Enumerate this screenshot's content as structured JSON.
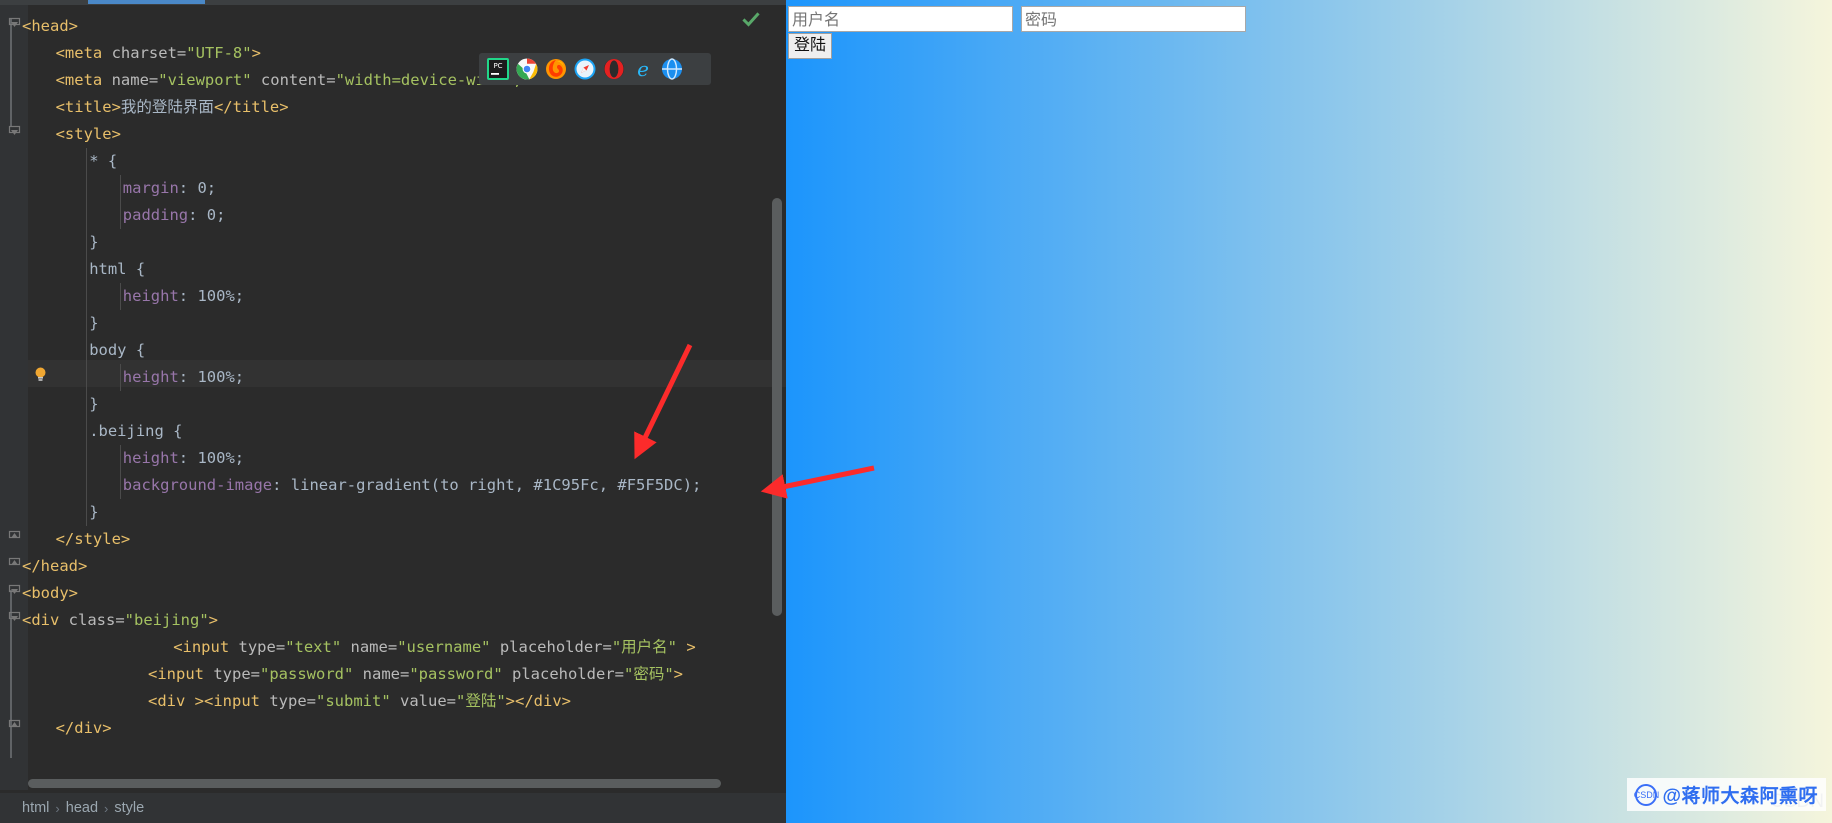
{
  "ide": {
    "breadcrumb": {
      "items": [
        "html",
        "head",
        "style"
      ],
      "separator": "›"
    },
    "inspection_status_icon": "green-check-icon",
    "browser_popup": {
      "icons": [
        {
          "name": "pycharm-icon",
          "label": "PC"
        },
        {
          "name": "chrome-icon",
          "label": ""
        },
        {
          "name": "firefox-icon",
          "label": ""
        },
        {
          "name": "safari-icon",
          "label": ""
        },
        {
          "name": "opera-icon",
          "label": "O"
        },
        {
          "name": "edge-ie-icon",
          "label": "e"
        },
        {
          "name": "extra-browser-icon",
          "label": ""
        }
      ]
    },
    "code": {
      "lines": [
        {
          "indent": 0,
          "tokens": [
            {
              "c": "t-tag",
              "t": "<head>"
            }
          ]
        },
        {
          "indent": 4,
          "tokens": [
            {
              "c": "t-tag",
              "t": "<meta "
            },
            {
              "c": "t-attr",
              "t": "charset="
            },
            {
              "c": "t-str",
              "t": "\"UTF-8\""
            },
            {
              "c": "t-tag",
              "t": ">"
            }
          ]
        },
        {
          "indent": 4,
          "tokens": [
            {
              "c": "t-tag",
              "t": "<meta "
            },
            {
              "c": "t-attr",
              "t": "name="
            },
            {
              "c": "t-str",
              "t": "\"viewport\""
            },
            {
              "c": "t-attr",
              "t": " content="
            },
            {
              "c": "t-str",
              "t": "\"width=device-width, initial-scale=1.0\""
            },
            {
              "c": "t-tag",
              "t": ">"
            }
          ]
        },
        {
          "indent": 4,
          "tokens": [
            {
              "c": "t-tag",
              "t": "<title>"
            },
            {
              "c": "t-text",
              "t": "我的登陆界面"
            },
            {
              "c": "t-tag",
              "t": "</title>"
            }
          ]
        },
        {
          "indent": 4,
          "tokens": [
            {
              "c": "t-tag",
              "t": "<style>"
            }
          ]
        },
        {
          "indent": 8,
          "tokens": [
            {
              "c": "t-css-sel",
              "t": "* {"
            }
          ]
        },
        {
          "indent": 12,
          "tokens": [
            {
              "c": "t-css-prop",
              "t": "margin"
            },
            {
              "c": "t-punct",
              "t": ": "
            },
            {
              "c": "t-plain",
              "t": "0;"
            }
          ]
        },
        {
          "indent": 12,
          "tokens": [
            {
              "c": "t-css-prop",
              "t": "padding"
            },
            {
              "c": "t-punct",
              "t": ": "
            },
            {
              "c": "t-plain",
              "t": "0;"
            }
          ]
        },
        {
          "indent": 8,
          "tokens": [
            {
              "c": "t-punct",
              "t": "}"
            }
          ]
        },
        {
          "indent": 8,
          "tokens": [
            {
              "c": "t-css-sel",
              "t": "html {"
            }
          ]
        },
        {
          "indent": 12,
          "tokens": [
            {
              "c": "t-css-prop",
              "t": "height"
            },
            {
              "c": "t-punct",
              "t": ": "
            },
            {
              "c": "t-plain",
              "t": "100%;"
            }
          ]
        },
        {
          "indent": 8,
          "tokens": [
            {
              "c": "t-punct",
              "t": "}"
            }
          ]
        },
        {
          "indent": 8,
          "tokens": [
            {
              "c": "t-css-sel",
              "t": "body {"
            }
          ]
        },
        {
          "indent": 12,
          "tokens": [
            {
              "c": "t-css-prop",
              "t": "height"
            },
            {
              "c": "t-punct",
              "t": ": "
            },
            {
              "c": "t-plain",
              "t": "100%;"
            }
          ]
        },
        {
          "indent": 8,
          "tokens": [
            {
              "c": "t-punct",
              "t": "}"
            }
          ]
        },
        {
          "indent": 8,
          "tokens": [
            {
              "c": "t-css-sel",
              "t": ".beijing {"
            }
          ]
        },
        {
          "indent": 12,
          "tokens": [
            {
              "c": "t-css-prop",
              "t": "height"
            },
            {
              "c": "t-punct",
              "t": ": "
            },
            {
              "c": "t-plain",
              "t": "100%;"
            }
          ]
        },
        {
          "indent": 12,
          "tokens": [
            {
              "c": "t-css-prop",
              "t": "background-image"
            },
            {
              "c": "t-punct",
              "t": ": "
            },
            {
              "c": "t-plain",
              "t": "linear-gradient(to right, #1C95Fc, #F5F5DC);"
            }
          ]
        },
        {
          "indent": 8,
          "tokens": [
            {
              "c": "t-punct",
              "t": "}"
            }
          ]
        },
        {
          "indent": 4,
          "tokens": [
            {
              "c": "t-tag",
              "t": "</style>"
            }
          ]
        },
        {
          "indent": 0,
          "tokens": [
            {
              "c": "t-tag",
              "t": "</head>"
            }
          ]
        },
        {
          "indent": 0,
          "tokens": [
            {
              "c": "t-tag",
              "t": "<body>"
            }
          ]
        },
        {
          "indent": 0,
          "tokens": [
            {
              "c": "t-tag",
              "t": "<div "
            },
            {
              "c": "t-attr",
              "t": "class="
            },
            {
              "c": "t-str",
              "t": "\"beijing\""
            },
            {
              "c": "t-tag",
              "t": ">"
            }
          ]
        },
        {
          "indent": 18,
          "tokens": [
            {
              "c": "t-tag",
              "t": "<input "
            },
            {
              "c": "t-attr",
              "t": "type="
            },
            {
              "c": "t-str",
              "t": "\"text\""
            },
            {
              "c": "t-attr",
              "t": " name="
            },
            {
              "c": "t-str",
              "t": "\"username\""
            },
            {
              "c": "t-attr",
              "t": " placeholder="
            },
            {
              "c": "t-str",
              "t": "\"用户名\""
            },
            {
              "c": "t-tag",
              "t": " >"
            }
          ]
        },
        {
          "indent": 15,
          "tokens": [
            {
              "c": "t-tag",
              "t": "<input "
            },
            {
              "c": "t-attr",
              "t": "type="
            },
            {
              "c": "t-str",
              "t": "\"password\""
            },
            {
              "c": "t-attr",
              "t": " name="
            },
            {
              "c": "t-str",
              "t": "\"password\""
            },
            {
              "c": "t-attr",
              "t": " placeholder="
            },
            {
              "c": "t-str",
              "t": "\"密码\""
            },
            {
              "c": "t-tag",
              "t": ">"
            }
          ]
        },
        {
          "indent": 15,
          "tokens": [
            {
              "c": "t-tag",
              "t": "<div >"
            },
            {
              "c": "t-tag",
              "t": "<input "
            },
            {
              "c": "t-attr",
              "t": "type="
            },
            {
              "c": "t-str",
              "t": "\"submit\""
            },
            {
              "c": "t-attr",
              "t": " value="
            },
            {
              "c": "t-str",
              "t": "\"登陆\""
            },
            {
              "c": "t-tag",
              "t": ">"
            },
            {
              "c": "t-tag",
              "t": "</div>"
            }
          ]
        },
        {
          "indent": 4,
          "tokens": [
            {
              "c": "t-tag",
              "t": "</div>"
            }
          ]
        }
      ],
      "current_line_index": 13,
      "bulb_line_index": 13
    }
  },
  "preview": {
    "username_input": {
      "value": "",
      "placeholder": "用户名"
    },
    "password_input": {
      "value": "",
      "placeholder": "密码"
    },
    "submit_button": {
      "label": "登陆"
    },
    "gradient_from": "#1C95Fc",
    "gradient_to": "#F5F5DC"
  },
  "watermark": {
    "prefix": "CSDN",
    "handle": "@蒋师大森阿熏呀",
    "logo_text": "CSDN"
  }
}
